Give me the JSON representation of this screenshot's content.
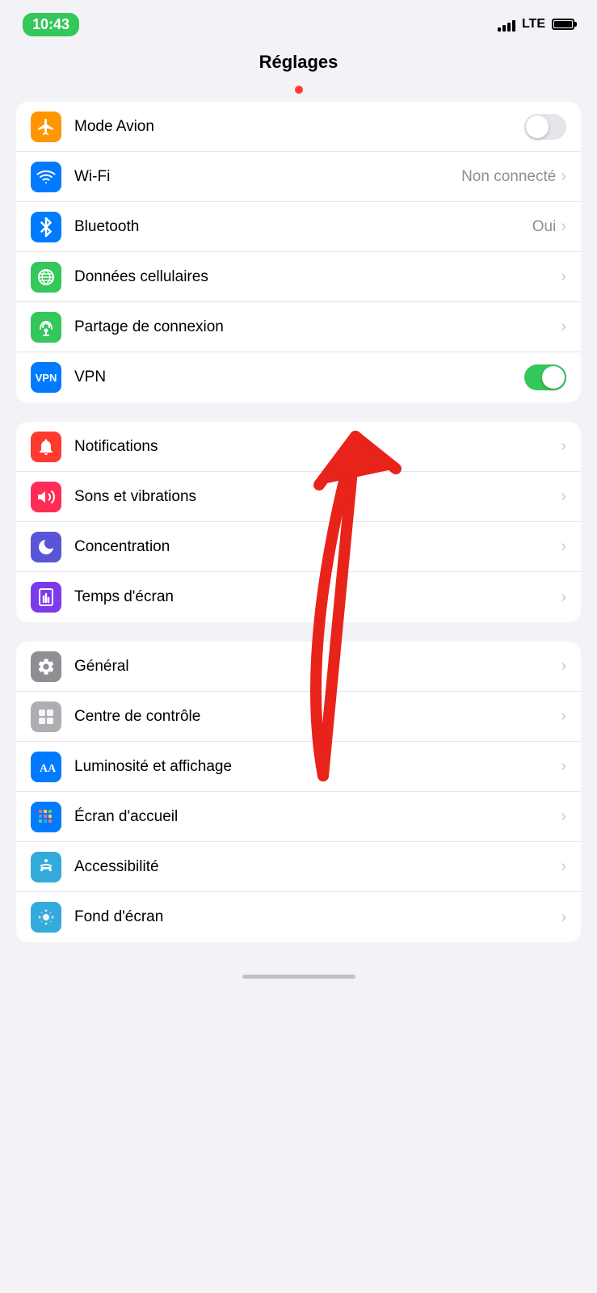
{
  "statusBar": {
    "time": "10:43",
    "lte": "LTE"
  },
  "pageTitle": "Réglages",
  "groups": [
    {
      "id": "network",
      "rows": [
        {
          "id": "mode-avion",
          "label": "Mode Avion",
          "iconColor": "ic-orange",
          "icon": "airplane",
          "control": "toggle",
          "toggleOn": false
        },
        {
          "id": "wifi",
          "label": "Wi-Fi",
          "iconColor": "ic-blue",
          "icon": "wifi",
          "control": "chevron",
          "value": "Non connecté"
        },
        {
          "id": "bluetooth",
          "label": "Bluetooth",
          "iconColor": "ic-blue2",
          "icon": "bluetooth",
          "control": "chevron",
          "value": "Oui"
        },
        {
          "id": "donnees",
          "label": "Données cellulaires",
          "iconColor": "ic-green",
          "icon": "cellular",
          "control": "chevron",
          "value": ""
        },
        {
          "id": "partage",
          "label": "Partage de connexion",
          "iconColor": "ic-green2",
          "icon": "hotspot",
          "control": "chevron",
          "value": ""
        },
        {
          "id": "vpn",
          "label": "VPN",
          "iconColor": "ic-blue-vpn",
          "icon": "vpn",
          "control": "toggle",
          "toggleOn": true
        }
      ]
    },
    {
      "id": "notifications-group",
      "rows": [
        {
          "id": "notifications",
          "label": "Notifications",
          "iconColor": "ic-red",
          "icon": "bell",
          "control": "chevron",
          "value": ""
        },
        {
          "id": "sons",
          "label": "Sons et vibrations",
          "iconColor": "ic-pink",
          "icon": "speaker",
          "control": "chevron",
          "value": ""
        },
        {
          "id": "concentration",
          "label": "Concentration",
          "iconColor": "ic-purple",
          "icon": "moon",
          "control": "chevron",
          "value": ""
        },
        {
          "id": "temps-ecran",
          "label": "Temps d'écran",
          "iconColor": "ic-purple2",
          "icon": "hourglass",
          "control": "chevron",
          "value": ""
        }
      ]
    },
    {
      "id": "general-group",
      "rows": [
        {
          "id": "general",
          "label": "Général",
          "iconColor": "ic-gray",
          "icon": "gear",
          "control": "chevron",
          "value": ""
        },
        {
          "id": "centre-controle",
          "label": "Centre de contrôle",
          "iconColor": "ic-gray2",
          "icon": "switches",
          "control": "chevron",
          "value": ""
        },
        {
          "id": "luminosite",
          "label": "Luminosité et affichage",
          "iconColor": "ic-blue3",
          "icon": "aa",
          "control": "chevron",
          "value": ""
        },
        {
          "id": "ecran-accueil",
          "label": "Écran d'accueil",
          "iconColor": "ic-blue4",
          "icon": "grid",
          "control": "chevron",
          "value": ""
        },
        {
          "id": "accessibilite",
          "label": "Accessibilité",
          "iconColor": "ic-blue5",
          "icon": "accessibility",
          "control": "chevron",
          "value": ""
        },
        {
          "id": "fond-ecran",
          "label": "Fond d'écran",
          "iconColor": "ic-blue4",
          "icon": "flower",
          "control": "chevron",
          "value": ""
        }
      ]
    }
  ]
}
